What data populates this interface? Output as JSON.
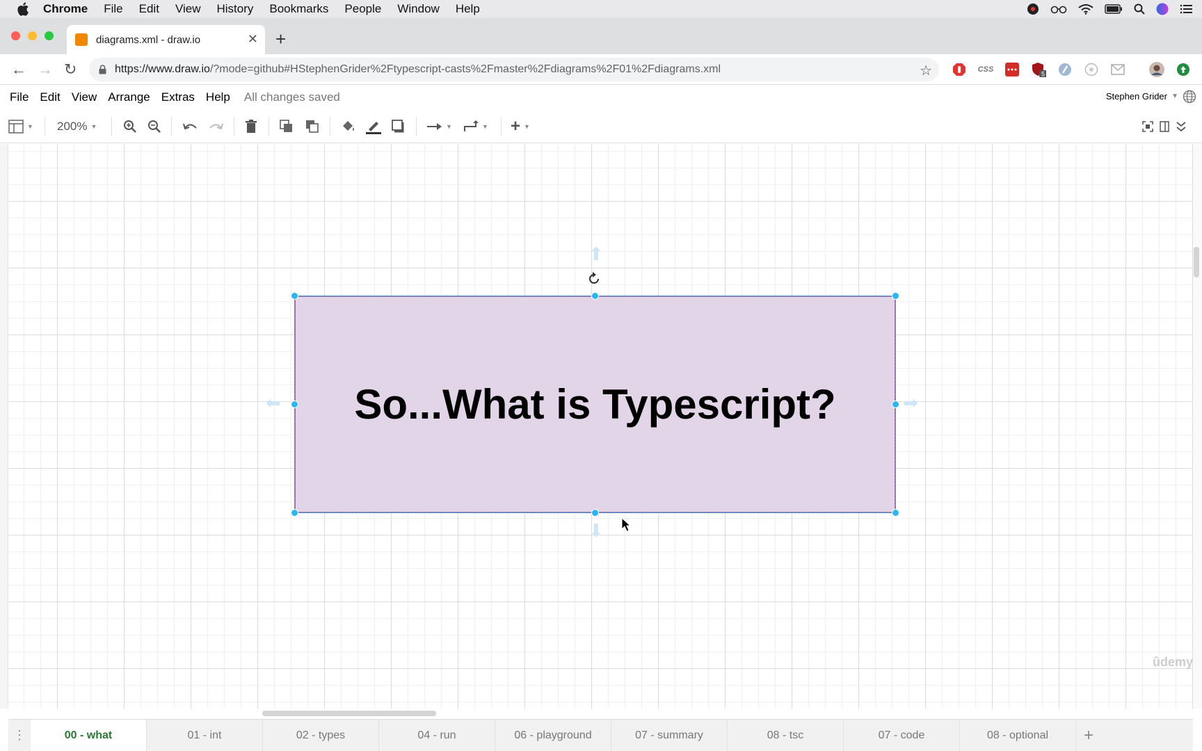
{
  "mac_menubar": {
    "app_name": "Chrome",
    "items": [
      "File",
      "Edit",
      "View",
      "History",
      "Bookmarks",
      "People",
      "Window",
      "Help"
    ]
  },
  "browser": {
    "tab_title": "diagrams.xml - draw.io",
    "url_host": "https://www.draw.io",
    "url_rest": "/?mode=github#HStephenGrider%2Ftypescript-casts%2Fmaster%2Fdiagrams%2F01%2Fdiagrams.xml",
    "extension_badge": "5",
    "css_extension": "CSS"
  },
  "app": {
    "menu": [
      "File",
      "Edit",
      "View",
      "Arrange",
      "Extras",
      "Help"
    ],
    "status": "All changes saved",
    "user": "Stephen Grider",
    "zoom": "200%"
  },
  "diagram": {
    "shape_label": "So...What is Typescript?",
    "fill_color": "#e1d5e7",
    "stroke_color": "#9673a6",
    "selection_color": "#29b6f2"
  },
  "pages": {
    "tabs": [
      "00 - what",
      "01 - int",
      "02 - types",
      "04 - run",
      "06 - playground",
      "07 - summary",
      "08 - tsc",
      "07 - code",
      "08 - optional"
    ],
    "active_index": 0
  },
  "watermark": "ûdemy"
}
